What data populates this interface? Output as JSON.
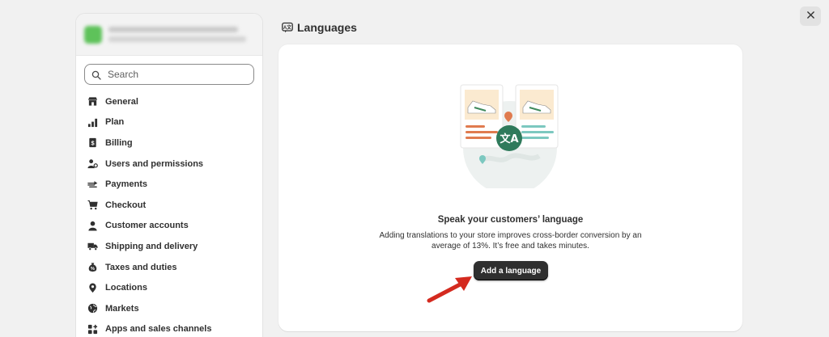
{
  "store": {
    "name": "",
    "domain": ""
  },
  "search": {
    "placeholder": "Search"
  },
  "sidebar": {
    "items": [
      {
        "label": "General",
        "icon": "store-icon"
      },
      {
        "label": "Plan",
        "icon": "plan-icon"
      },
      {
        "label": "Billing",
        "icon": "billing-icon"
      },
      {
        "label": "Users and permissions",
        "icon": "users-icon"
      },
      {
        "label": "Payments",
        "icon": "payments-icon"
      },
      {
        "label": "Checkout",
        "icon": "cart-icon"
      },
      {
        "label": "Customer accounts",
        "icon": "person-icon"
      },
      {
        "label": "Shipping and delivery",
        "icon": "truck-icon"
      },
      {
        "label": "Taxes and duties",
        "icon": "tax-icon"
      },
      {
        "label": "Locations",
        "icon": "location-icon"
      },
      {
        "label": "Markets",
        "icon": "globe-icon"
      },
      {
        "label": "Apps and sales channels",
        "icon": "apps-icon"
      }
    ]
  },
  "header": {
    "title": "Languages",
    "title_icon": "language-icon"
  },
  "empty_state": {
    "heading": "Speak your customers’ language",
    "description": "Adding translations to your store improves cross-border conversion by an average of 13%. It’s free and takes minutes.",
    "button_label": "Add a language"
  },
  "colors": {
    "accent_green": "#2f7a5b",
    "button_dark": "#2f2f2f",
    "arrow_red": "#d42a1f",
    "line_orange": "#e07b4f",
    "line_teal": "#7cc8c0"
  }
}
